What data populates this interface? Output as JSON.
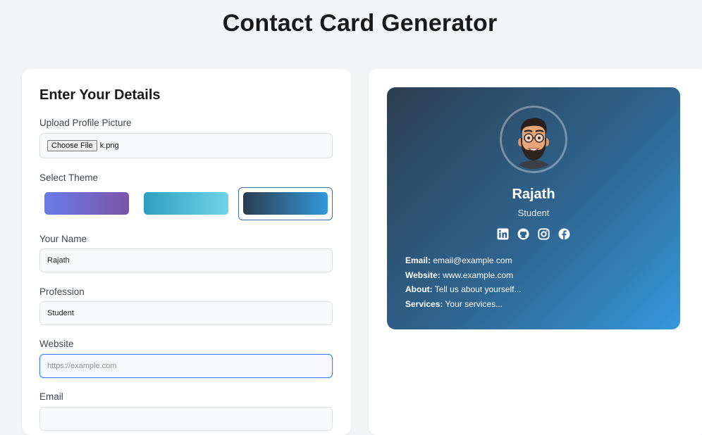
{
  "title": "Contact Card Generator",
  "form": {
    "heading": "Enter Your Details",
    "upload_label": "Upload Profile Picture",
    "choose_file_label": "Choose File",
    "file_name": "k.png",
    "theme_label": "Select Theme",
    "themes": [
      {
        "name": "purple",
        "selected": false,
        "colors": [
          "#6a7bea",
          "#7b55a8"
        ]
      },
      {
        "name": "cyan",
        "selected": false,
        "colors": [
          "#2ea0bf",
          "#6fd3e8"
        ]
      },
      {
        "name": "dark-blue",
        "selected": true,
        "colors": [
          "#2c3e50",
          "#3498db"
        ]
      }
    ],
    "name_label": "Your Name",
    "name_value": "Rajath",
    "profession_label": "Profession",
    "profession_value": "Student",
    "website_label": "Website",
    "website_placeholder": "https://example.com",
    "email_label": "Email"
  },
  "card": {
    "name": "Rajath",
    "profession": "Student",
    "social_icons": [
      "linkedin-icon",
      "github-icon",
      "instagram-icon",
      "facebook-icon"
    ],
    "email_key": "Email:",
    "email_value": "email@example.com",
    "website_key": "Website:",
    "website_value": "www.example.com",
    "about_key": "About:",
    "about_value": "Tell us about yourself...",
    "services_key": "Services:",
    "services_value": "Your services..."
  }
}
